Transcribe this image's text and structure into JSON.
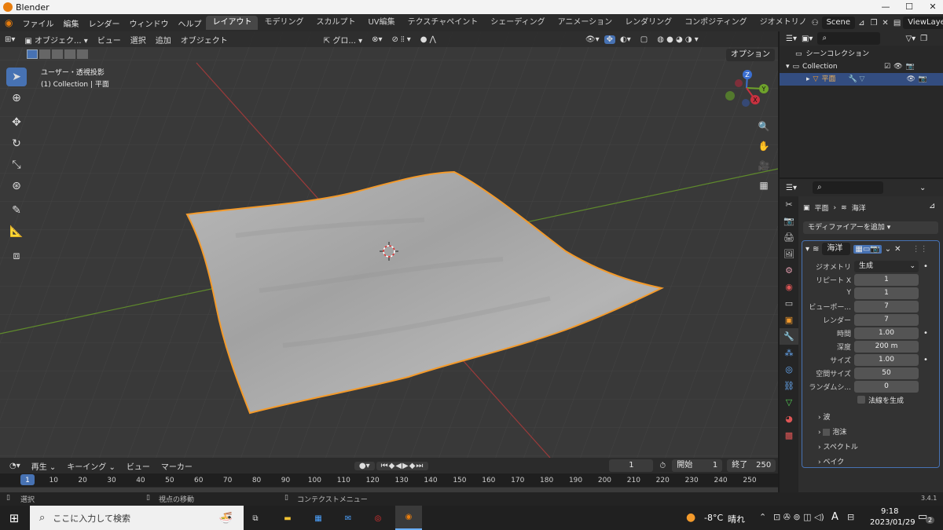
{
  "window": {
    "title": "Blender",
    "minimize": "—",
    "maximize": "☐",
    "close": "✕"
  },
  "menu": [
    "ファイル",
    "編集",
    "レンダー",
    "ウィンドウ",
    "ヘルプ"
  ],
  "workspaces": [
    "レイアウト",
    "モデリング",
    "スカルプト",
    "UV編集",
    "テクスチャペイント",
    "シェーディング",
    "アニメーション",
    "レンダリング",
    "コンポジティング",
    "ジオメトリノ"
  ],
  "scene": {
    "name": "Scene",
    "view_layer": "ViewLayer"
  },
  "viewport": {
    "header": {
      "mode": "オブジェク...",
      "menus": [
        "ビュー",
        "選択",
        "追加",
        "オブジェクト"
      ],
      "transform": "グロ...",
      "options": "オプション"
    },
    "overlay_text": {
      "line1": "ユーザー・透視投影",
      "line2": "(1) Collection | 平面"
    },
    "gizmo": {
      "z": "Z",
      "y": "Y",
      "x": "X"
    },
    "colors": {
      "background": "#393939",
      "grid": "#444444",
      "x_axis": "#9b3a3a",
      "y_axis": "#5f8a2c",
      "selection": "#f39a2b"
    }
  },
  "outliner": {
    "scene_collection": "シーンコレクション",
    "collection": "Collection",
    "object": "平面"
  },
  "properties": {
    "breadcrumb_object": "平面",
    "breadcrumb_modifier": "海洋",
    "add_modifier": "モディファイアーを追加",
    "modifier_name": "海洋",
    "rows": [
      {
        "label": "ジオメトリ",
        "value": "生成"
      },
      {
        "label": "リピート X",
        "value": "1"
      },
      {
        "label": "Y",
        "value": "1"
      },
      {
        "label": "ビューポー...",
        "value": "7"
      },
      {
        "label": "レンダー",
        "value": "7"
      },
      {
        "label": "時間",
        "value": "1.00"
      },
      {
        "label": "深度",
        "value": "200 m"
      },
      {
        "label": "サイズ",
        "value": "1.00"
      },
      {
        "label": "空間サイズ",
        "value": "50"
      },
      {
        "label": "ランダムシ...",
        "value": "0"
      }
    ],
    "checkbox_normals": "法線を生成",
    "subpanels": [
      "波",
      "泡沫",
      "スペクトル",
      "ベイク"
    ]
  },
  "timeline": {
    "menus": [
      "再生",
      "キーイング",
      "ビュー",
      "マーカー"
    ],
    "current_frame": "1",
    "start_label": "開始",
    "start": "1",
    "end_label": "終了",
    "end": "250",
    "ticks": [
      "1",
      "10",
      "20",
      "30",
      "40",
      "50",
      "60",
      "70",
      "80",
      "90",
      "100",
      "110",
      "120",
      "130",
      "140",
      "150",
      "160",
      "170",
      "180",
      "190",
      "200",
      "210",
      "220",
      "230",
      "240",
      "250"
    ]
  },
  "statusbar": {
    "select": "選択",
    "rotate": "視点の移動",
    "context": "コンテクストメニュー",
    "version": "3.4.1"
  },
  "taskbar": {
    "search_placeholder": "ここに入力して検索",
    "temperature": "-8°C",
    "weather": "晴れ",
    "ime": "A",
    "time": "9:18",
    "date": "2023/01/29",
    "notifications": "2"
  }
}
